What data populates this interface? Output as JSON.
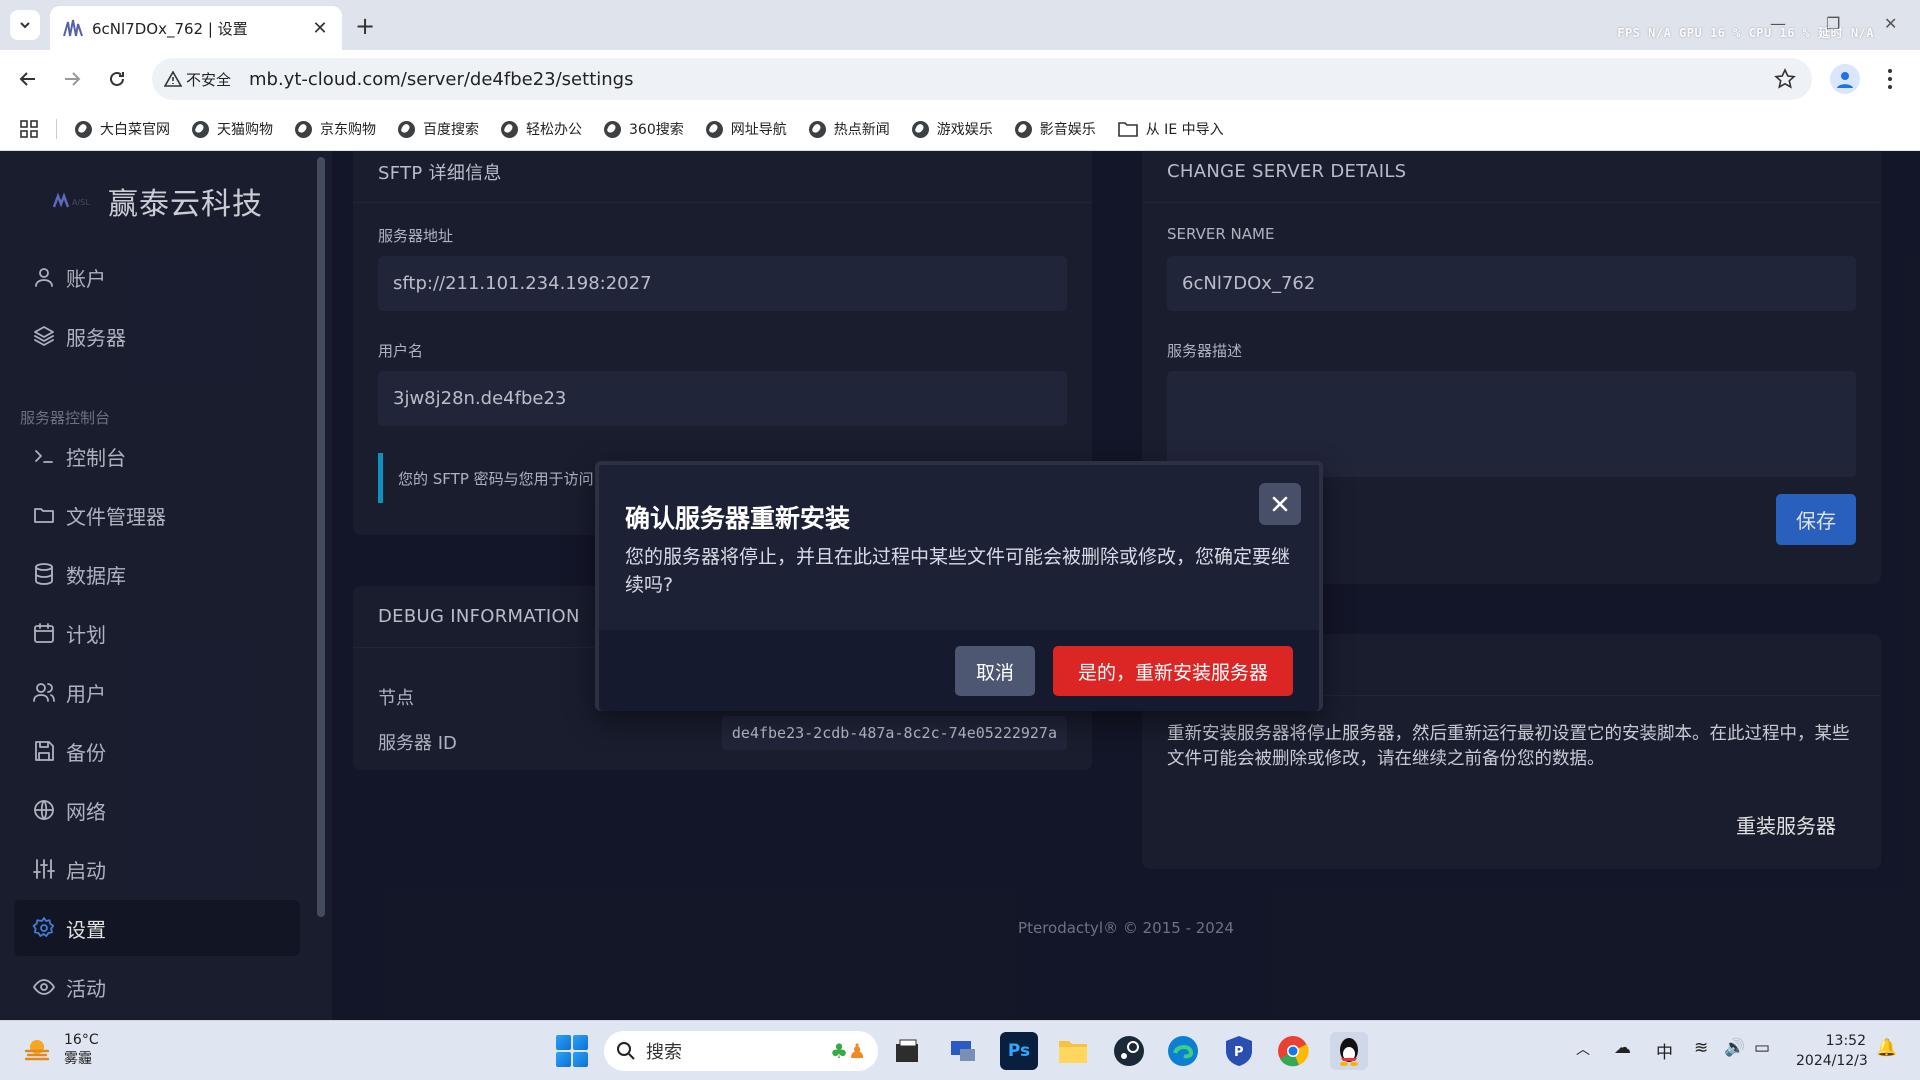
{
  "browser": {
    "tab_title": "6cNl7DOx_762 | 设置",
    "new_tab": "+",
    "perf_overlay": "FPS  N/A  GPU  16 % CPU  16 % 延时  N/A",
    "insecure_label": "不安全",
    "url": "mb.yt-cloud.com/server/de4fbe23/settings",
    "bookmarks": [
      "大白菜官网",
      "天猫购物",
      "京东购物",
      "百度搜索",
      "轻松办公",
      "360搜索",
      "网址导航",
      "热点新闻",
      "游戏娱乐",
      "影音娱乐"
    ],
    "import_bookmark": "从 IE 中导入"
  },
  "sidebar": {
    "brand": "赢泰云科技",
    "items": [
      "账户",
      "服务器"
    ],
    "section_label": "服务器控制台",
    "server_items": [
      "控制台",
      "文件管理器",
      "数据库",
      "计划",
      "用户",
      "备份",
      "网络",
      "启动",
      "设置",
      "活动"
    ],
    "active_item": "设置"
  },
  "sftp": {
    "title": "SFTP 详细信息",
    "address_label": "服务器地址",
    "address_value": "sftp://211.101.234.198:2027",
    "username_label": "用户名",
    "username_value": "3jw8j28n.de4fbe23",
    "note": "您的 SFTP 密码与您用于访问"
  },
  "change_details": {
    "title": "CHANGE SERVER DETAILS",
    "name_label": "SERVER NAME",
    "name_value": "6cNl7DOx_762",
    "desc_label": "服务器描述",
    "desc_value": "",
    "save_label": "保存"
  },
  "debug": {
    "title": "DEBUG INFORMATION",
    "node_label": "节点",
    "id_label": "服务器 ID",
    "id_value": "de4fbe23-2cdb-487a-8c2c-74e05222927a"
  },
  "reinstall": {
    "description": "重新安装服务器将停止服务器，然后重新运行最初设置它的安装脚本。在此过程中，某些文件可能会被删除或修改，请在继续之前备份您的数据。",
    "button_label": "重装服务器"
  },
  "footer": "Pterodactyl® © 2015 - 2024",
  "modal": {
    "title": "确认服务器重新安装",
    "body": "您的服务器将停止，并且在此过程中某些文件可能会被删除或修改，您确定要继续吗?",
    "cancel_label": "取消",
    "confirm_label": "是的，重新安装服务器"
  },
  "taskbar": {
    "temperature": "16°C",
    "weather": "雾霾",
    "search_label": "搜索",
    "ps_label": "Ps",
    "ime": "中",
    "time": "13:52",
    "date": "2024/12/3"
  },
  "colors": {
    "page_bg": "#161a2e",
    "card_bg": "#1d2135",
    "input_bg": "#262b42",
    "primary": "#2f6ed8",
    "danger": "#dc2626",
    "accent_cyan": "#10a6d9"
  }
}
